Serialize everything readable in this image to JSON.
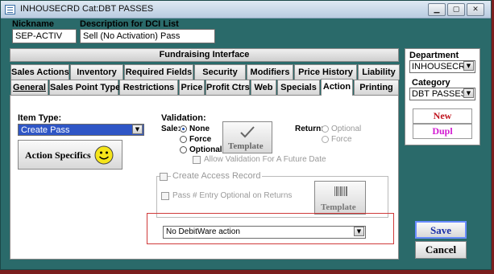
{
  "window": {
    "title": "INHOUSECRD  Cat:DBT PASSES"
  },
  "header": {
    "nickname_label": "Nickname",
    "nickname_value": "SEP-ACTIV",
    "description_label": "Description for DCI List",
    "description_value": "Sell (No Activation) Pass"
  },
  "fundraising_label": "Fundraising Interface",
  "tabs_row1": [
    "Sales Actions",
    "Inventory",
    "Required Fields",
    "Security",
    "Modifiers",
    "Price History",
    "Liability"
  ],
  "tabs_row2": [
    "General",
    "Sales Point Type",
    "Restrictions",
    "Price",
    "Profit Ctrs",
    "Web",
    "Specials",
    "Action",
    "Printing"
  ],
  "active_tab": "Action",
  "action": {
    "item_type_label": "Item Type:",
    "item_type_value": "Create Pass",
    "action_specifics_label": "Action Specifics",
    "validation_label": "Validation:",
    "sale_label": "Sale:",
    "sale_options": [
      "None",
      "Force",
      "Optional"
    ],
    "sale_selected": "None",
    "template_label": "Template",
    "return_label": "Return:",
    "return_options": [
      "Optional",
      "Force"
    ],
    "allow_future_label": "Allow Validation For A Future Date",
    "create_access_label": "Create Access Record",
    "pass_entry_label": "Pass # Entry Optional on Returns",
    "template2_label": "Template",
    "debitware_value": "No DebitWare action"
  },
  "sidebar": {
    "department_label": "Department",
    "department_value": "INHOUSECRD",
    "category_label": "Category",
    "category_value": "DBT PASSES",
    "new_label": "New",
    "dupl_label": "Dupl"
  },
  "footer": {
    "save_label": "Save",
    "cancel_label": "Cancel"
  },
  "colors": {
    "window_bg": "#2a6a6a",
    "highlight": "#2f56c6",
    "new_color": "#c0141e",
    "dupl_color": "#d21ad2",
    "save_color": "#1b2fa8",
    "red_frame": "#d03a3a"
  }
}
